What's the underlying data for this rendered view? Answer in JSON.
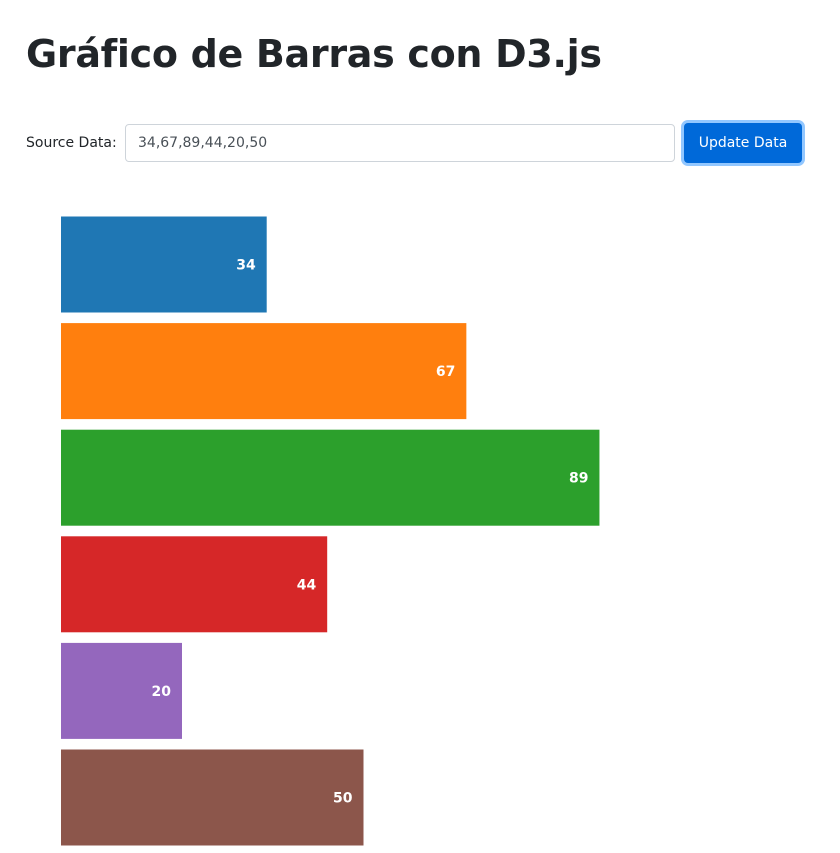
{
  "header": {
    "title": "Gráfico de Barras con D3.js"
  },
  "controls": {
    "source_label": "Source Data:",
    "source_value": "34,67,89,44,20,50",
    "update_label": "Update Data"
  },
  "colors": {
    "accent": "#0069d9",
    "bars": [
      "#1f77b4",
      "#ff7f0e",
      "#2ca02c",
      "#d62728",
      "#9467bd",
      "#8c564b"
    ]
  },
  "chart_data": {
    "type": "bar",
    "orientation": "horizontal",
    "values": [
      34,
      67,
      89,
      44,
      20,
      50
    ],
    "xlim": [
      0,
      100
    ],
    "title": "",
    "xlabel": "",
    "ylabel": "",
    "grid": false,
    "data_labels": true
  }
}
